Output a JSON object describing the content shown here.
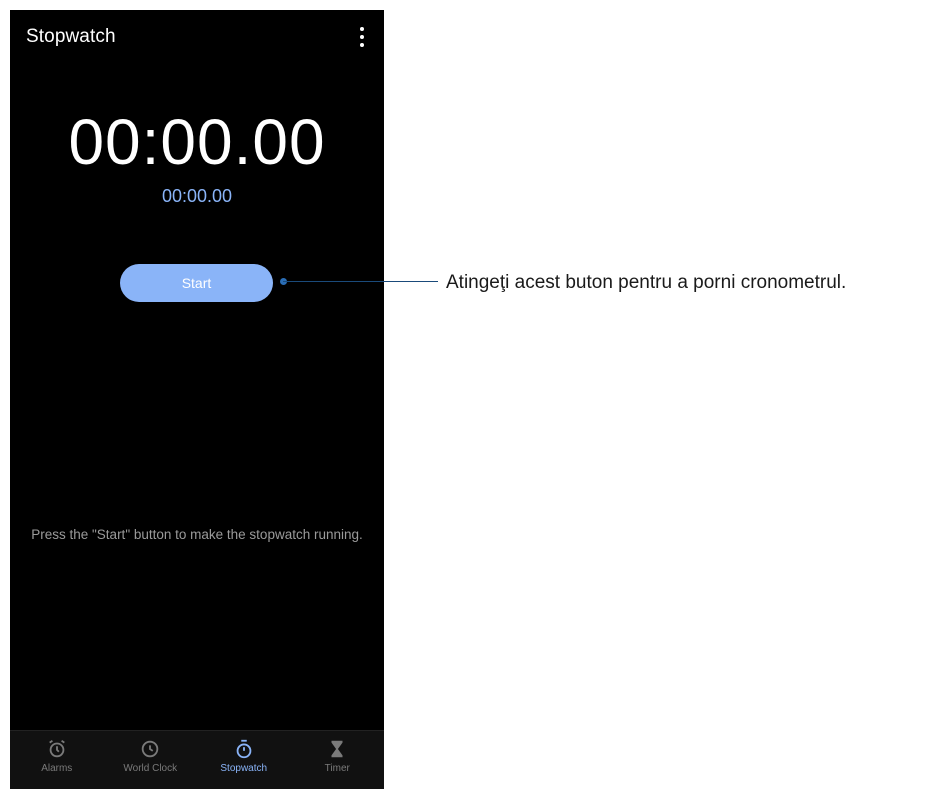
{
  "app": {
    "title": "Stopwatch",
    "menu_icon": "more-vert-icon"
  },
  "stopwatch": {
    "main_time": "00:00.00",
    "lap_time": "00:00.00",
    "start_label": "Start",
    "hint": "Press the \"Start\" button to make the stopwatch running."
  },
  "nav": {
    "items": [
      {
        "label": "Alarms",
        "icon": "alarm-clock-icon",
        "active": false
      },
      {
        "label": "World Clock",
        "icon": "clock-icon",
        "active": false
      },
      {
        "label": "Stopwatch",
        "icon": "stopwatch-icon",
        "active": true
      },
      {
        "label": "Timer",
        "icon": "hourglass-icon",
        "active": false
      }
    ]
  },
  "annotation": {
    "text": "Atingeţi acest buton pentru a porni cronometrul."
  },
  "colors": {
    "accent": "#8ab4f8",
    "background": "#000000",
    "callout": "#1a4a7a"
  }
}
